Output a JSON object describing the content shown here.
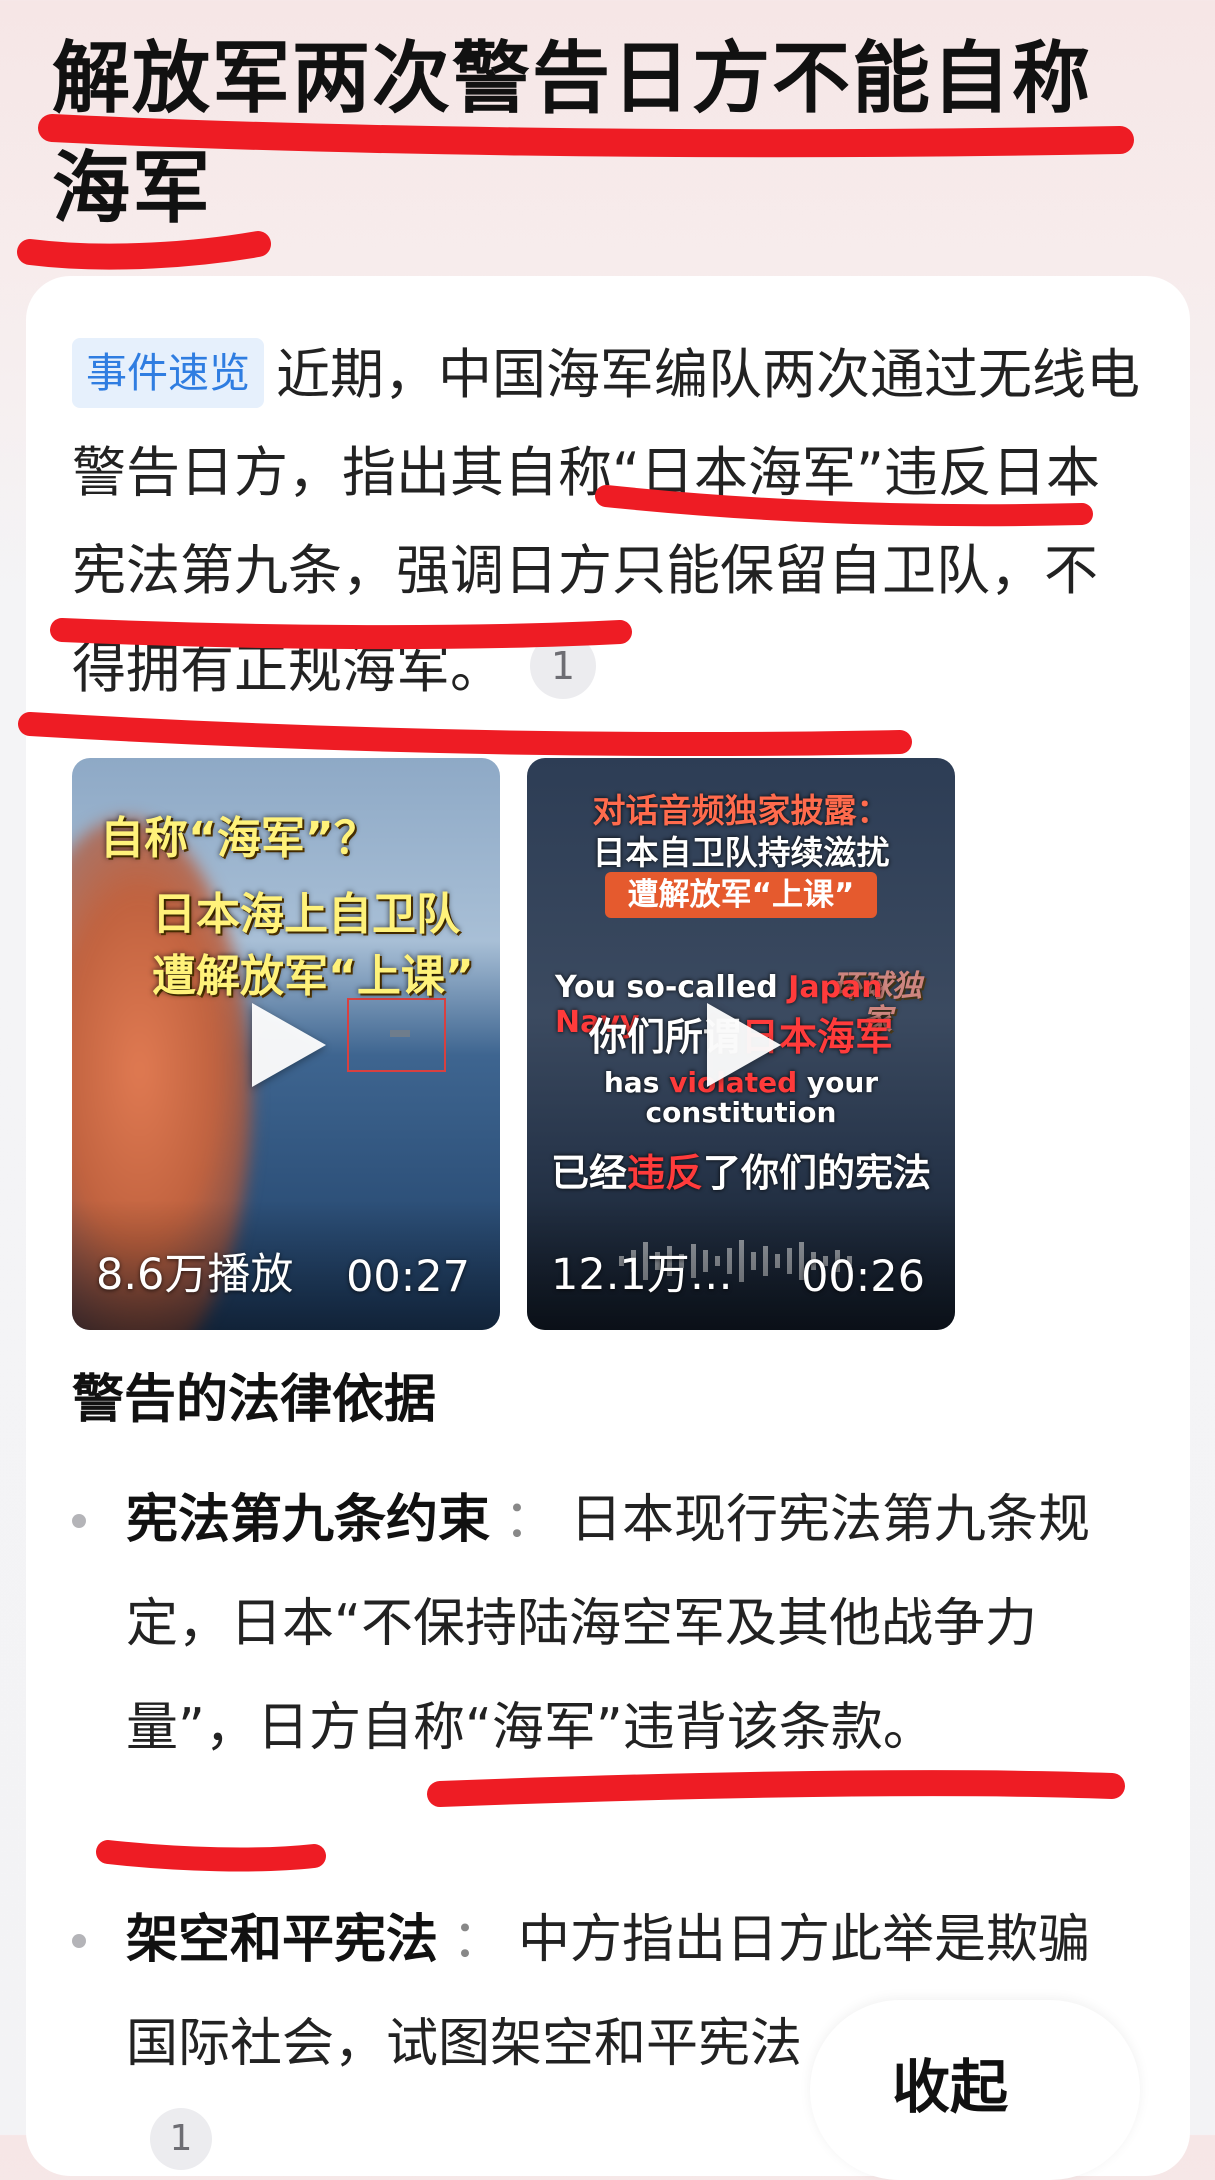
{
  "header": {
    "title": "解放军两次警告日方不能自称海军"
  },
  "summary": {
    "tag": "事件速览",
    "text": "近期，中国海军编队两次通过无线电警告日方，指出其自称“日本海军”违反日本宪法第九条，强调日方只能保留自卫队，不得拥有正规海军。",
    "citation": "1"
  },
  "videos": [
    {
      "overlay": [
        "自称“海军”？",
        "日本海上自卫队",
        "遭解放军“上课”"
      ],
      "views": "8.6万播放",
      "duration": "00:27"
    },
    {
      "overlay": {
        "line1": "对话音频独家披露：",
        "line2": "日本自卫队持续滋扰",
        "line3": "遭解放军“上课”",
        "watermark": "环球独家",
        "en1_pre": "You so-called ",
        "en1_red": "Japan Navy",
        "zh1_pre": "你们所谓",
        "zh1_red": "日本海军",
        "en2_pre": "has ",
        "en2_red": "violated",
        "en2_post": " your",
        "en3": "constitution",
        "zh2_pre": "已经",
        "zh2_red": "违反",
        "zh2_post": "了你们的宪法"
      },
      "views": "12.1万…",
      "duration": "00:26"
    }
  ],
  "section": {
    "heading": "警告的法律依据"
  },
  "bullets": [
    {
      "term": "宪法第九条约束",
      "sep": "：",
      "text": "日本现行宪法第九条规定，日本“不保持陆海空军及其他战争力量”，日方自称“海军”违背该条款。"
    },
    {
      "term": "架空和平宪法",
      "sep": "：",
      "text": "中方指出日方此举是欺骗国际社会，试图架空和平宪法"
    }
  ],
  "collapse": {
    "label": "收起"
  },
  "footer_citation": "1",
  "colors": {
    "annotation_red": "#ee1c24",
    "tag_blue": "#2f7de1",
    "tag_bg": "#e6f0fc"
  }
}
